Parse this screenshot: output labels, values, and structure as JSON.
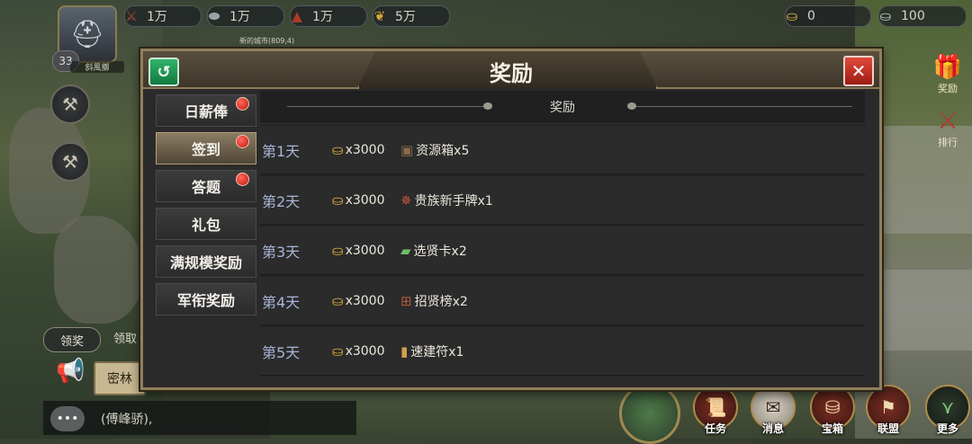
{
  "topbar": {
    "resources": [
      {
        "icon": "crossed-swords-icon",
        "value": "1万"
      },
      {
        "icon": "stone-icon",
        "value": "1万"
      },
      {
        "icon": "ore-icon",
        "value": "1万"
      },
      {
        "icon": "wheat-icon",
        "value": "5万"
      },
      {
        "icon": "gold-ingot-icon",
        "value": "0"
      },
      {
        "icon": "silver-ingot-icon",
        "value": "100"
      }
    ],
    "city": "新的城市(809,4)"
  },
  "player": {
    "level": "33",
    "name": "斜風擲"
  },
  "modal": {
    "title": "奖励",
    "tabs": [
      {
        "label": "日薪俸",
        "dot": true
      },
      {
        "label": "签到",
        "dot": true,
        "active": true
      },
      {
        "label": "答题",
        "dot": true
      },
      {
        "label": "礼包",
        "dot": false
      },
      {
        "label": "满规模奖励",
        "dot": false
      },
      {
        "label": "军衔奖励",
        "dot": false
      }
    ],
    "content_header": "奖励",
    "rows": [
      {
        "day": "第1天",
        "gold": "x3000",
        "item": "资源箱x5",
        "item_icon": "chest-icon"
      },
      {
        "day": "第2天",
        "gold": "x3000",
        "item": "贵族新手牌x1",
        "item_icon": "noble-badge-icon"
      },
      {
        "day": "第3天",
        "gold": "x3000",
        "item": "选贤卡x2",
        "item_icon": "card-icon"
      },
      {
        "day": "第4天",
        "gold": "x3000",
        "item": "招贤榜x2",
        "item_icon": "board-icon"
      },
      {
        "day": "第5天",
        "gold": "x3000",
        "item": "速建符x1",
        "item_icon": "talisman-icon"
      }
    ]
  },
  "side": {
    "reward": "奖励",
    "rank": "排行"
  },
  "chat": {
    "lingjiang": "领奖",
    "lingqu": "领取",
    "milin": "密林",
    "message": "(傅峰骄),"
  },
  "bottom_menu": [
    "任务",
    "消息",
    "宝箱",
    "联盟",
    "更多"
  ]
}
